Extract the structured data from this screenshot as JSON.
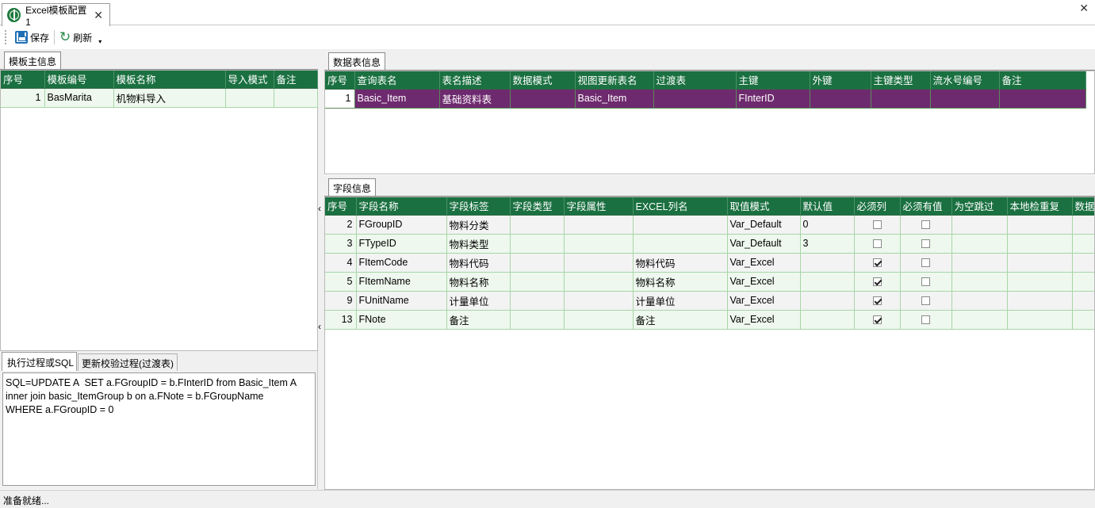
{
  "window": {
    "tab_title": "Excel模板配置1",
    "tab_close": "✕",
    "window_close": "✕"
  },
  "toolbar": {
    "save_label": "保存",
    "refresh_label": "刷新",
    "dropdown": "▾"
  },
  "template_master": {
    "tab": "模板主信息",
    "columns": [
      "序号",
      "模板编号",
      "模板名称",
      "导入模式",
      "备注"
    ],
    "rows": [
      [
        "1",
        "BasMarita",
        "机物料导入",
        "",
        ""
      ]
    ]
  },
  "bottom_left": {
    "tabs": [
      "执行过程或SQL",
      "更新校验过程(过渡表)"
    ],
    "sql": "SQL=UPDATE A  SET a.FGroupID = b.FInterID from Basic_Item A inner join basic_ItemGroup b on a.FNote = b.FGroupName\nWHERE a.FGroupID = 0"
  },
  "table_info": {
    "tab": "数据表信息",
    "columns": [
      "序号",
      "查询表名",
      "表名描述",
      "数据模式",
      "视图更新表名",
      "过渡表",
      "主键",
      "外键",
      "主键类型",
      "流水号编号",
      "备注"
    ],
    "rows": [
      [
        "1",
        "Basic_Item",
        "基础资料表",
        "",
        "Basic_Item",
        "",
        "FInterID",
        "",
        "",
        "",
        ""
      ]
    ]
  },
  "field_info": {
    "tab": "字段信息",
    "columns": [
      "序号",
      "字段名称",
      "字段标签",
      "字段类型",
      "字段属性",
      "EXCEL列名",
      "取值模式",
      "默认值",
      "必须列",
      "必须有值",
      "为空跳过",
      "本地检重复",
      "数据"
    ],
    "rows": [
      {
        "no": "2",
        "name": "FGroupID",
        "label": "物料分类",
        "type": "",
        "attr": "",
        "excel": "",
        "mode": "Var_Default",
        "default": "0",
        "required_col": false,
        "required_val": false
      },
      {
        "no": "3",
        "name": "FTypeID",
        "label": "物料类型",
        "type": "",
        "attr": "",
        "excel": "",
        "mode": "Var_Default",
        "default": "3",
        "required_col": false,
        "required_val": false
      },
      {
        "no": "4",
        "name": "FItemCode",
        "label": "物料代码",
        "type": "",
        "attr": "",
        "excel": "物料代码",
        "mode": "Var_Excel",
        "default": "",
        "required_col": true,
        "required_val": false
      },
      {
        "no": "5",
        "name": "FItemName",
        "label": "物料名称",
        "type": "",
        "attr": "",
        "excel": "物料名称",
        "mode": "Var_Excel",
        "default": "",
        "required_col": true,
        "required_val": false
      },
      {
        "no": "9",
        "name": "FUnitName",
        "label": "计量单位",
        "type": "",
        "attr": "",
        "excel": "计量单位",
        "mode": "Var_Excel",
        "default": "",
        "required_col": true,
        "required_val": false
      },
      {
        "no": "13",
        "name": "FNote",
        "label": "备注",
        "type": "",
        "attr": "",
        "excel": "备注",
        "mode": "Var_Excel",
        "default": "",
        "required_col": true,
        "required_val": false
      }
    ]
  },
  "splitter_arrows": [
    "‹",
    "‹"
  ],
  "status": "准备就绪..."
}
